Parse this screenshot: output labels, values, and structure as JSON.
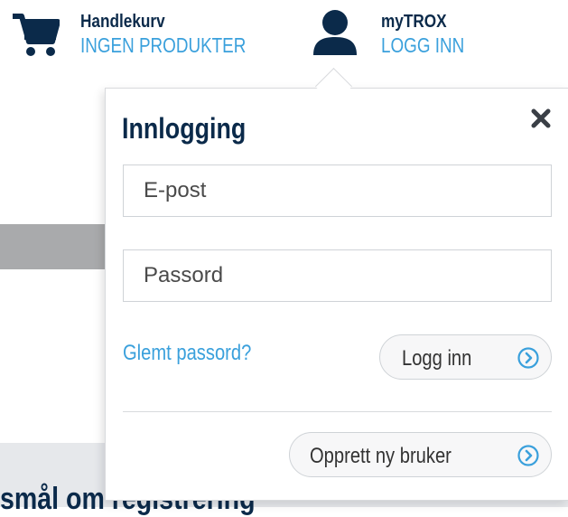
{
  "header": {
    "cart": {
      "icon": "cart-icon",
      "title": "Handlekurv",
      "status": "INGEN PRODUKTER"
    },
    "account": {
      "icon": "user-icon",
      "title": "myTROX",
      "action": "LOGG INN"
    }
  },
  "background": {
    "heading": "smål om registrering"
  },
  "login_popover": {
    "title": "Innlogging",
    "close_icon": "close-icon",
    "email_placeholder": "E-post",
    "password_placeholder": "Passord",
    "forgot_link": "Glemt passord?",
    "login_button": "Logg inn",
    "create_button": "Opprett ny bruker",
    "button_icon": "circle-chevron-right-icon"
  },
  "colors": {
    "navy": "#0b2a4a",
    "accent_blue": "#3aa0dc",
    "border": "#cfd3d7"
  }
}
